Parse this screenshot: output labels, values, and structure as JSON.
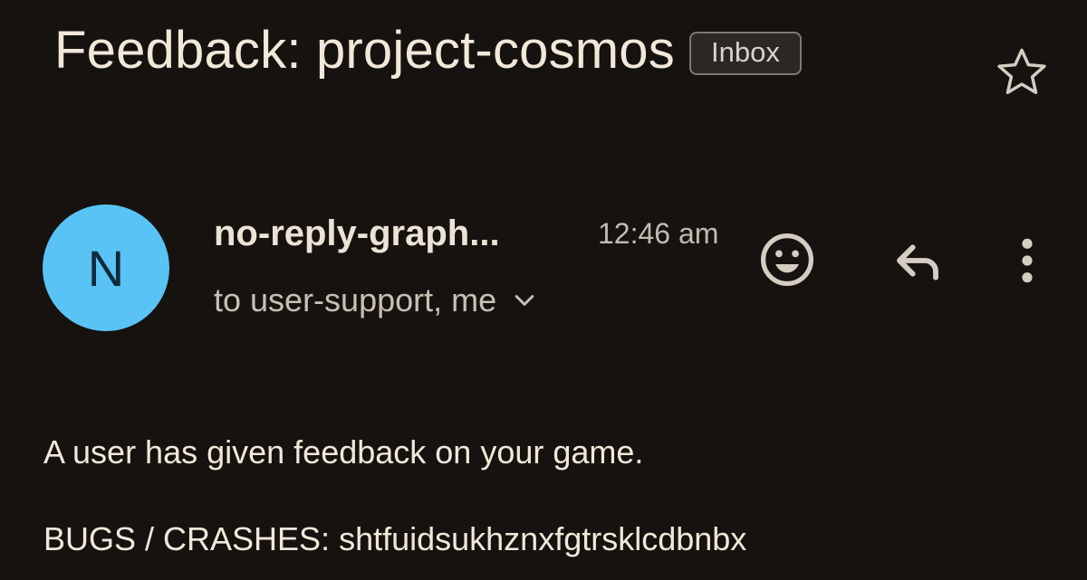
{
  "email": {
    "subject": "Feedback: project-cosmos",
    "label": "Inbox",
    "sender": {
      "avatar_initial": "N",
      "name": "no-reply-graph...",
      "time": "12:46 am",
      "recipients": "to user-support, me"
    },
    "body": {
      "line1": "A user has given feedback on your game.",
      "line2": "BUGS / CRASHES: shtfuidsukhznxfgtrsklcdbnbx"
    }
  },
  "icons": {
    "star": "star-outline-icon",
    "emoji": "add-emoji-reaction-icon",
    "reply": "reply-icon",
    "more": "more-vertical-icon",
    "expand": "chevron-down-icon"
  },
  "colors": {
    "background": "#16120f",
    "text": "#ece3d6",
    "avatar": "#59c3f5",
    "badge_border": "#7f7870"
  }
}
